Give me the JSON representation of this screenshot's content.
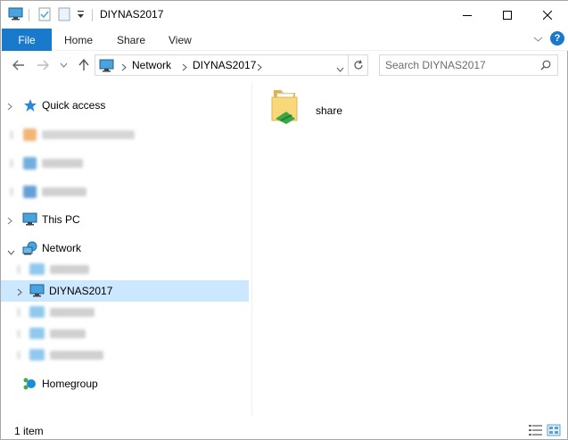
{
  "window": {
    "title": "DIYNAS2017",
    "minimize_glyph": "—",
    "maximize_glyph": "☐",
    "close_glyph": "✕"
  },
  "ribbon": {
    "tabs": [
      "File",
      "Home",
      "Share",
      "View"
    ],
    "help_glyph": "?",
    "file_tab_color": "#1979ca"
  },
  "address_bar": {
    "crumbs": [
      "Network",
      "DIYNAS2017"
    ]
  },
  "search": {
    "placeholder": "Search DIYNAS2017"
  },
  "nav_pane": {
    "quick_access": "Quick access",
    "this_pc": "This PC",
    "network": "Network",
    "selected_host": "DIYNAS2017",
    "homegroup": "Homegroup",
    "selection_color": "#cce8ff"
  },
  "content": {
    "items": [
      {
        "name": "share",
        "icon": "shared-folder-icon"
      }
    ]
  },
  "status_bar": {
    "item_count": "1 item"
  }
}
